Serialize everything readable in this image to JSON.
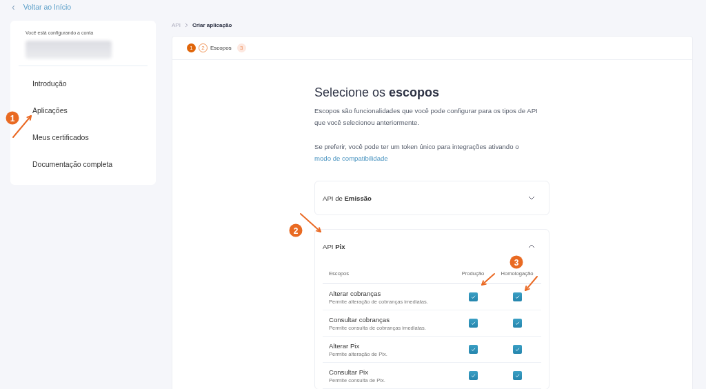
{
  "back_link": {
    "icon": "‹",
    "label": "Voltar ao Início"
  },
  "sidebar": {
    "account_caption": "Você está configurando a conta",
    "items": [
      {
        "label": "Introdução",
        "selected": false
      },
      {
        "label": "Aplicações",
        "selected": false
      },
      {
        "label": "Meus certificados",
        "selected": false
      },
      {
        "label": "Documentação completa",
        "selected": false
      }
    ]
  },
  "breadcrumb": [
    "API",
    "Criar aplicação"
  ],
  "stepper": [
    {
      "number": "1",
      "kind": "done"
    },
    {
      "number": "2",
      "kind": "current",
      "label": "Escopos"
    },
    {
      "number": "3",
      "kind": "pending"
    }
  ],
  "content": {
    "title": "Selecione os **escopos**",
    "description": "Escopos são funcionalidades que você pode configurar para os tipos de API que você selecionou anteriormente.",
    "hint": "Se preferir, você pode ter um token único para integrações ativando o",
    "hint_link": "modo de compatibilidade",
    "accordions": [
      {
        "title": "API de **Emissão**",
        "expanded": false
      },
      {
        "title": "API **Pix**",
        "expanded": true,
        "table": {
          "columns": [
            "Escopos",
            "Produção",
            "Homologação"
          ],
          "rows": [
            {
              "name": "Alterar cobranças",
              "description": "Permite alteração de cobranças imediatas.",
              "production": true,
              "homologation": true
            },
            {
              "name": "Consultar cobranças",
              "description": "Permite consulta de cobranças imediatas.",
              "production": true,
              "homologation": true
            },
            {
              "name": "Alterar Pix",
              "description": "Permite alteração de Pix.",
              "production": true,
              "homologation": true
            },
            {
              "name": "Consultar Pix",
              "description": "Permite consulta de Pix.",
              "production": true,
              "homologation": true
            }
          ]
        }
      }
    ]
  },
  "annotations": [
    {
      "label": "1"
    },
    {
      "label": "2"
    },
    {
      "label": "3"
    }
  ]
}
